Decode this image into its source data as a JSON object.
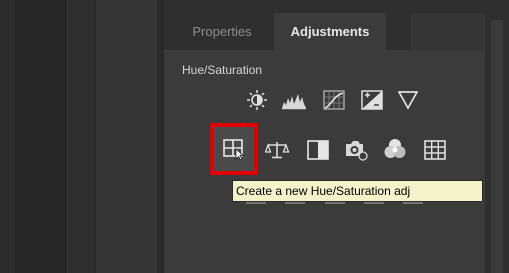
{
  "tabs": [
    {
      "label": "Properties"
    },
    {
      "label": "Adjustments"
    }
  ],
  "section_label": "Hue/Saturation",
  "icons_row1": [
    "brightness-contrast-icon",
    "levels-icon",
    "curves-icon",
    "exposure-icon",
    "vibrance-icon"
  ],
  "icons_row2": [
    "hue-saturation-icon",
    "color-balance-icon",
    "black-white-icon",
    "photo-filter-icon",
    "channel-mixer-icon",
    "color-lookup-icon"
  ],
  "tooltip": "Create a new Hue/Saturation adj",
  "colors": {
    "panel": "#3b3b3b",
    "highlight": "#e00000",
    "tooltip_bg": "#f4f2c9"
  }
}
